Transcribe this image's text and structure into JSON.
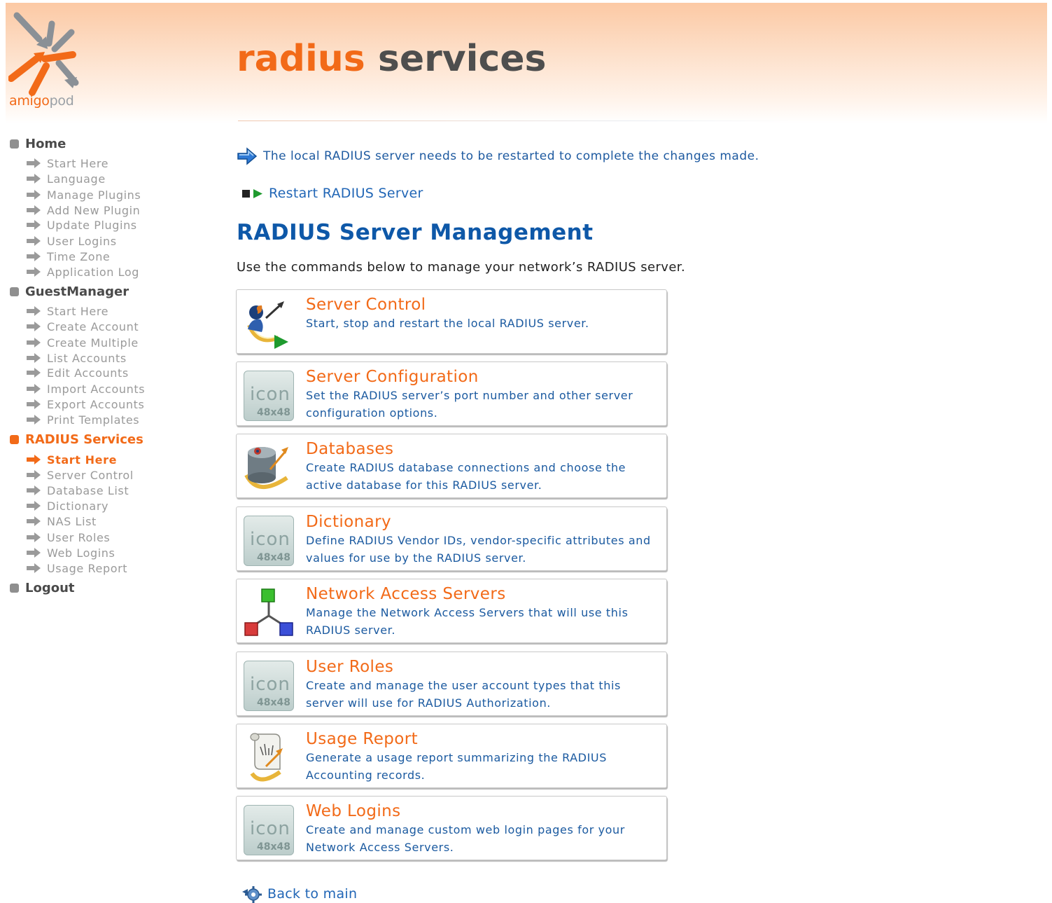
{
  "header": {
    "brand_main": "amigo",
    "brand_sub": "pod",
    "title_part1": "radius",
    "title_part2": " services"
  },
  "sidebar": {
    "sections": [
      {
        "label": "Home",
        "items": [
          "Start Here",
          "Language",
          "Manage Plugins",
          "Add New Plugin",
          "Update Plugins",
          "User Logins",
          "Time Zone",
          "Application Log"
        ]
      },
      {
        "label": "GuestManager",
        "items": [
          "Start Here",
          "Create Account",
          "Create Multiple",
          "List Accounts",
          "Edit Accounts",
          "Import Accounts",
          "Export Accounts",
          "Print Templates"
        ]
      },
      {
        "label": "RADIUS Services",
        "items": [
          "Start Here",
          "Server Control",
          "Database List",
          "Dictionary",
          "NAS List",
          "User Roles",
          "Web Logins",
          "Usage Report"
        ]
      },
      {
        "label": "Logout",
        "items": []
      }
    ],
    "active_section": "RADIUS Services",
    "active_item": "Start Here"
  },
  "main": {
    "notice": "The local RADIUS server needs to be restarted to complete the changes made.",
    "restart_link": "Restart RADIUS Server",
    "heading": "RADIUS Server Management",
    "intro": "Use the commands below to manage your network’s RADIUS server.",
    "commands": [
      {
        "title": "Server Control",
        "desc": "Start, stop and restart the local RADIUS server.",
        "icon": "server-control-icon"
      },
      {
        "title": "Server Configuration",
        "desc": "Set the RADIUS server’s port number and other server configuration options.",
        "icon": "placeholder-icon"
      },
      {
        "title": "Databases",
        "desc": "Create RADIUS database connections and choose the active database for this RADIUS server.",
        "icon": "database-icon"
      },
      {
        "title": "Dictionary",
        "desc": "Define RADIUS Vendor IDs, vendor-specific attributes and values for use by the RADIUS server.",
        "icon": "placeholder-icon"
      },
      {
        "title": "Network Access Servers",
        "desc": "Manage the Network Access Servers that will use this RADIUS server.",
        "icon": "network-icon"
      },
      {
        "title": "User Roles",
        "desc": "Create and manage the user account types that this server will use for RADIUS Authorization.",
        "icon": "placeholder-icon"
      },
      {
        "title": "Usage Report",
        "desc": "Generate a usage report summarizing the RADIUS Accounting records.",
        "icon": "report-scroll-icon"
      },
      {
        "title": "Web Logins",
        "desc": "Create and manage custom web login pages for your Network Access Servers.",
        "icon": "placeholder-icon"
      }
    ],
    "placeholder_word": "icon",
    "placeholder_size": "48x48",
    "back_link": "Back to main"
  },
  "colors": {
    "accent_orange": "#f26a18",
    "link_blue": "#2166b6",
    "heading_blue": "#0e58a8",
    "nav_gray": "#9a9a9a"
  }
}
